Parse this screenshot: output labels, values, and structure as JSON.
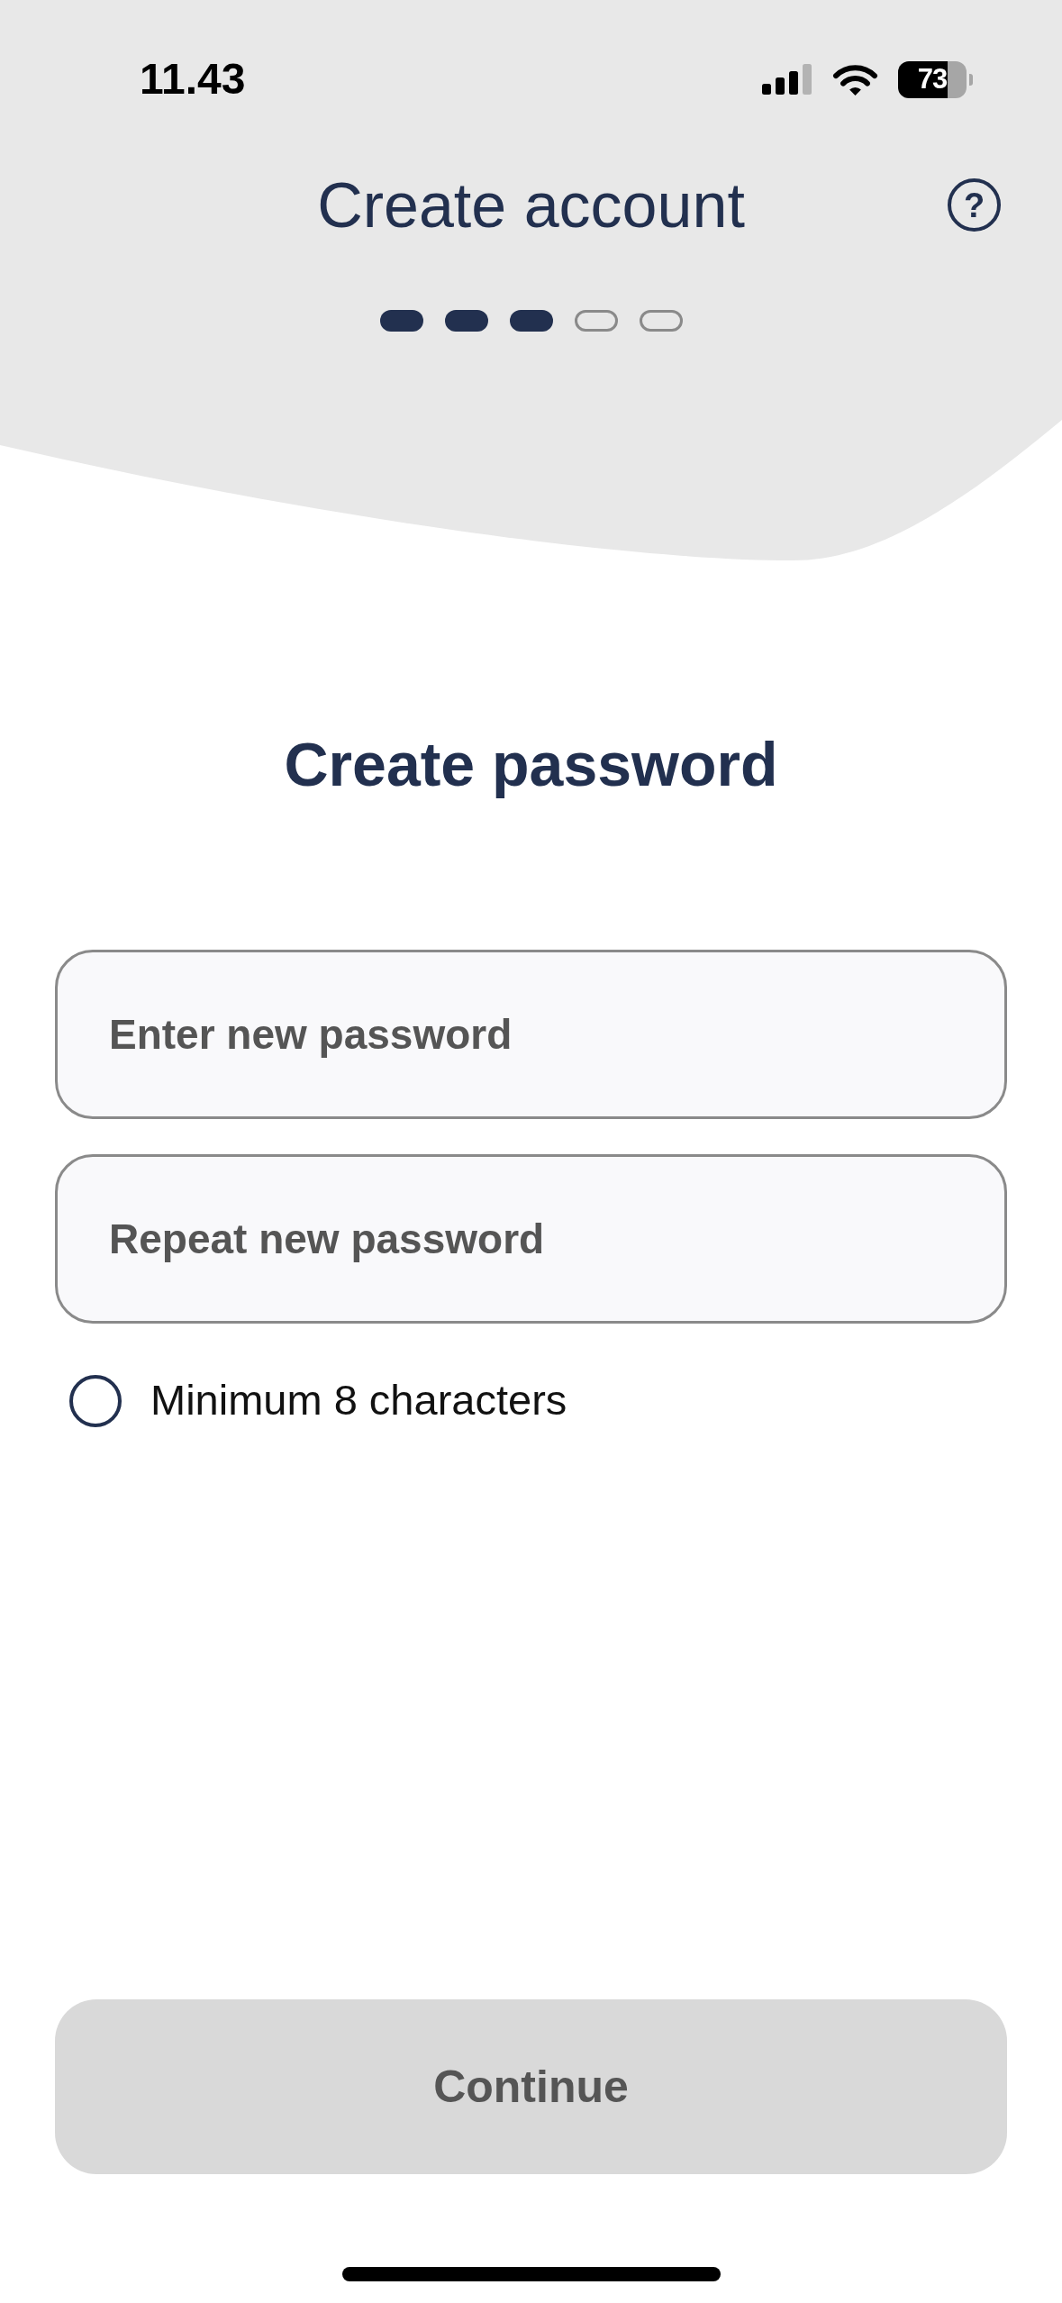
{
  "status_bar": {
    "time": "11.43",
    "battery": "73"
  },
  "header": {
    "title": "Create account",
    "help_button": {
      "label": "?"
    },
    "steps": [
      {
        "completed": true
      },
      {
        "completed": true
      },
      {
        "completed": true
      },
      {
        "completed": false
      },
      {
        "completed": false
      }
    ]
  },
  "heading": "Create password",
  "fields": [
    {
      "placeholder": "Enter new password"
    },
    {
      "placeholder": "Repeat new password"
    }
  ],
  "requirements": [
    {
      "label": "Minimum 8 characters",
      "met": false
    }
  ],
  "continue_button": {
    "label": "Continue",
    "disabled": true
  }
}
